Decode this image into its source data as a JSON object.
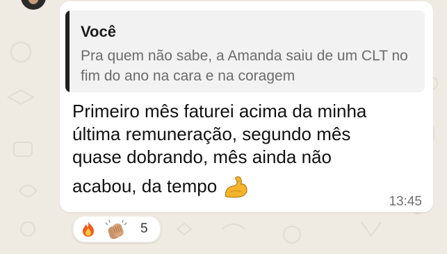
{
  "sender_name": "",
  "quote": {
    "author": "Você",
    "text": "Pra quem não sabe, a Amanda saiu de um CLT no fim do ano na cara e na coragem"
  },
  "message": {
    "lines": [
      "Primeiro mês faturei acima da minha",
      "última remuneração, segundo mês",
      "quase dobrando, mês ainda não",
      "acabou, da tempo"
    ],
    "trailing_icon": "flexed-biceps-icon",
    "time": "13:45"
  },
  "reactions": {
    "icons": [
      "fire-icon",
      "clapping-hands-icon"
    ],
    "count": "5"
  },
  "colors": {
    "background": "#efeae2",
    "bubble": "#ffffff",
    "quote_background": "#f2f2f2",
    "quote_bar": "#1f1f1f",
    "time": "#707070"
  }
}
